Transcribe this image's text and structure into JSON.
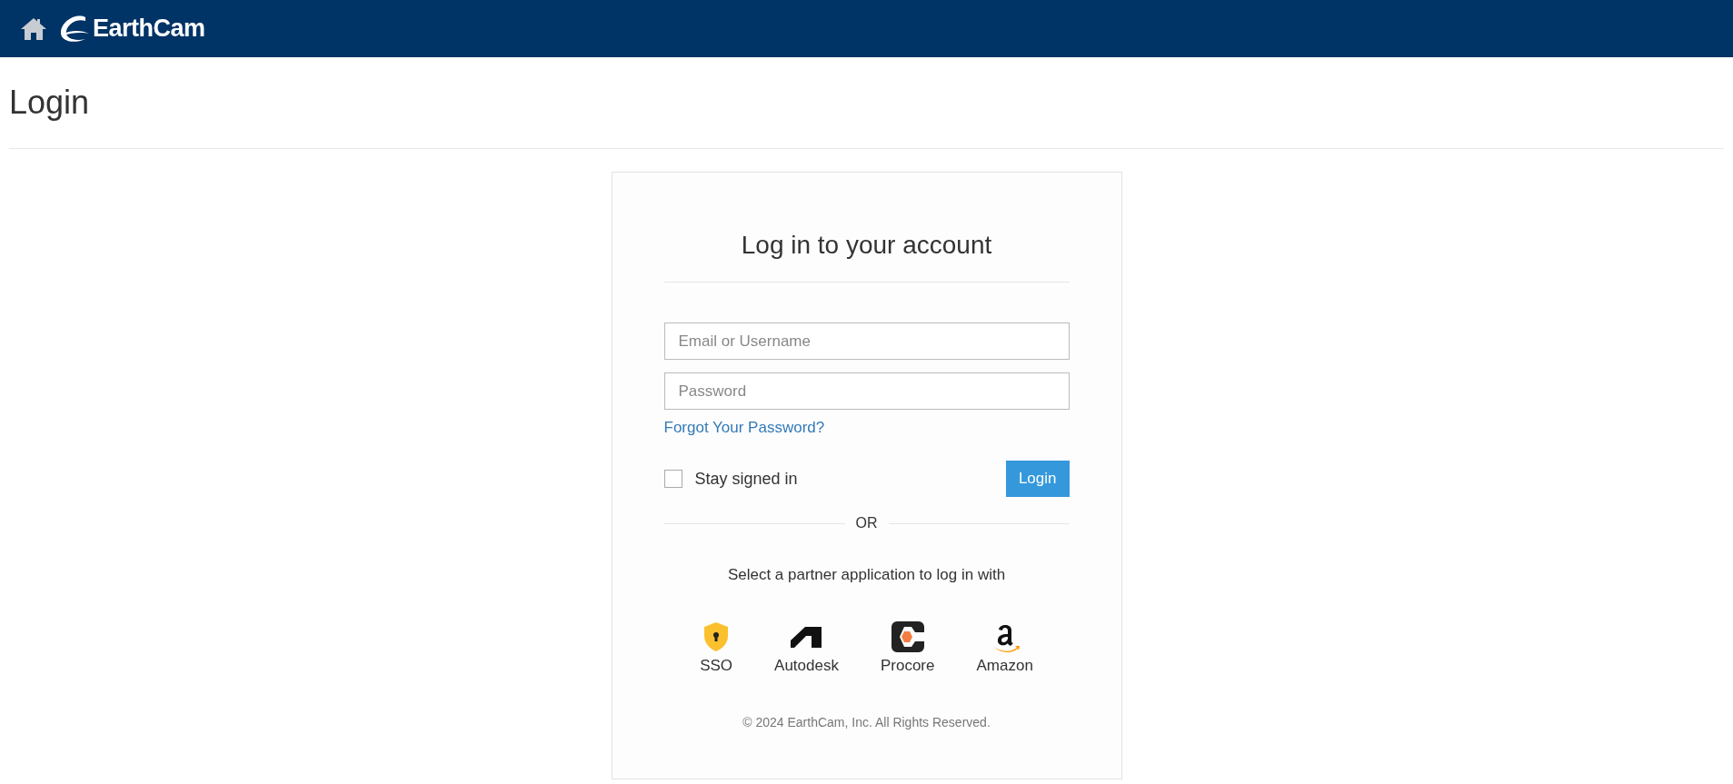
{
  "header": {
    "logo_text": "EarthCam"
  },
  "page_title": "Login",
  "card": {
    "title": "Log in to your account",
    "username_field": {
      "placeholder": "Email or Username"
    },
    "password_field": {
      "placeholder": "Password"
    },
    "forgot_link": "Forgot Your Password?",
    "stay_signed_in": {
      "label": "Stay signed in",
      "checked": false
    },
    "login_button": "Login",
    "separator": "OR",
    "partner_prompt": "Select a partner application to log in with",
    "partners": [
      {
        "kind": "sso",
        "label": "SSO"
      },
      {
        "kind": "autodesk",
        "label": "Autodesk"
      },
      {
        "kind": "procore",
        "label": "Procore"
      },
      {
        "kind": "amazon",
        "label": "Amazon"
      }
    ],
    "copyright": "© 2024 EarthCam, Inc. All Rights Reserved."
  }
}
